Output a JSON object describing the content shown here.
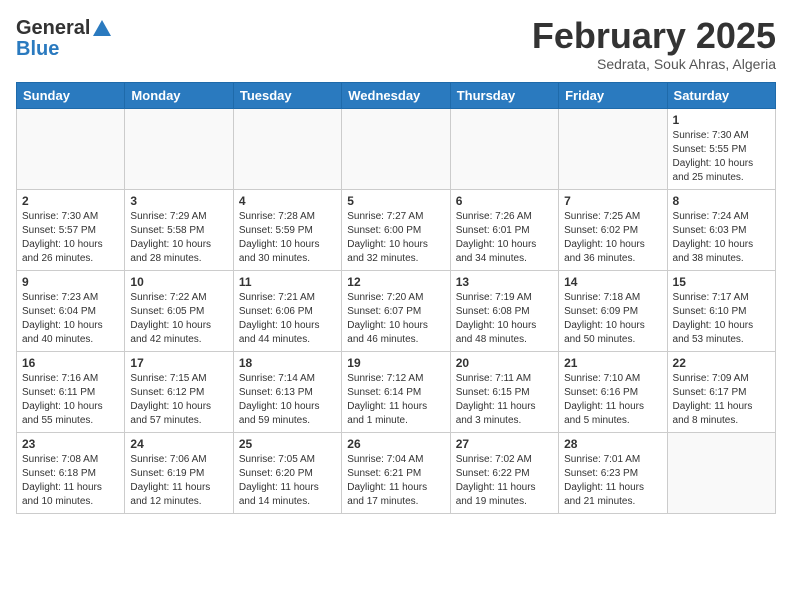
{
  "header": {
    "logo_line1": "General",
    "logo_line2": "Blue",
    "month": "February 2025",
    "location": "Sedrata, Souk Ahras, Algeria"
  },
  "days_of_week": [
    "Sunday",
    "Monday",
    "Tuesday",
    "Wednesday",
    "Thursday",
    "Friday",
    "Saturday"
  ],
  "weeks": [
    [
      {
        "day": "",
        "info": ""
      },
      {
        "day": "",
        "info": ""
      },
      {
        "day": "",
        "info": ""
      },
      {
        "day": "",
        "info": ""
      },
      {
        "day": "",
        "info": ""
      },
      {
        "day": "",
        "info": ""
      },
      {
        "day": "1",
        "info": "Sunrise: 7:30 AM\nSunset: 5:55 PM\nDaylight: 10 hours and 25 minutes."
      }
    ],
    [
      {
        "day": "2",
        "info": "Sunrise: 7:30 AM\nSunset: 5:57 PM\nDaylight: 10 hours and 26 minutes."
      },
      {
        "day": "3",
        "info": "Sunrise: 7:29 AM\nSunset: 5:58 PM\nDaylight: 10 hours and 28 minutes."
      },
      {
        "day": "4",
        "info": "Sunrise: 7:28 AM\nSunset: 5:59 PM\nDaylight: 10 hours and 30 minutes."
      },
      {
        "day": "5",
        "info": "Sunrise: 7:27 AM\nSunset: 6:00 PM\nDaylight: 10 hours and 32 minutes."
      },
      {
        "day": "6",
        "info": "Sunrise: 7:26 AM\nSunset: 6:01 PM\nDaylight: 10 hours and 34 minutes."
      },
      {
        "day": "7",
        "info": "Sunrise: 7:25 AM\nSunset: 6:02 PM\nDaylight: 10 hours and 36 minutes."
      },
      {
        "day": "8",
        "info": "Sunrise: 7:24 AM\nSunset: 6:03 PM\nDaylight: 10 hours and 38 minutes."
      }
    ],
    [
      {
        "day": "9",
        "info": "Sunrise: 7:23 AM\nSunset: 6:04 PM\nDaylight: 10 hours and 40 minutes."
      },
      {
        "day": "10",
        "info": "Sunrise: 7:22 AM\nSunset: 6:05 PM\nDaylight: 10 hours and 42 minutes."
      },
      {
        "day": "11",
        "info": "Sunrise: 7:21 AM\nSunset: 6:06 PM\nDaylight: 10 hours and 44 minutes."
      },
      {
        "day": "12",
        "info": "Sunrise: 7:20 AM\nSunset: 6:07 PM\nDaylight: 10 hours and 46 minutes."
      },
      {
        "day": "13",
        "info": "Sunrise: 7:19 AM\nSunset: 6:08 PM\nDaylight: 10 hours and 48 minutes."
      },
      {
        "day": "14",
        "info": "Sunrise: 7:18 AM\nSunset: 6:09 PM\nDaylight: 10 hours and 50 minutes."
      },
      {
        "day": "15",
        "info": "Sunrise: 7:17 AM\nSunset: 6:10 PM\nDaylight: 10 hours and 53 minutes."
      }
    ],
    [
      {
        "day": "16",
        "info": "Sunrise: 7:16 AM\nSunset: 6:11 PM\nDaylight: 10 hours and 55 minutes."
      },
      {
        "day": "17",
        "info": "Sunrise: 7:15 AM\nSunset: 6:12 PM\nDaylight: 10 hours and 57 minutes."
      },
      {
        "day": "18",
        "info": "Sunrise: 7:14 AM\nSunset: 6:13 PM\nDaylight: 10 hours and 59 minutes."
      },
      {
        "day": "19",
        "info": "Sunrise: 7:12 AM\nSunset: 6:14 PM\nDaylight: 11 hours and 1 minute."
      },
      {
        "day": "20",
        "info": "Sunrise: 7:11 AM\nSunset: 6:15 PM\nDaylight: 11 hours and 3 minutes."
      },
      {
        "day": "21",
        "info": "Sunrise: 7:10 AM\nSunset: 6:16 PM\nDaylight: 11 hours and 5 minutes."
      },
      {
        "day": "22",
        "info": "Sunrise: 7:09 AM\nSunset: 6:17 PM\nDaylight: 11 hours and 8 minutes."
      }
    ],
    [
      {
        "day": "23",
        "info": "Sunrise: 7:08 AM\nSunset: 6:18 PM\nDaylight: 11 hours and 10 minutes."
      },
      {
        "day": "24",
        "info": "Sunrise: 7:06 AM\nSunset: 6:19 PM\nDaylight: 11 hours and 12 minutes."
      },
      {
        "day": "25",
        "info": "Sunrise: 7:05 AM\nSunset: 6:20 PM\nDaylight: 11 hours and 14 minutes."
      },
      {
        "day": "26",
        "info": "Sunrise: 7:04 AM\nSunset: 6:21 PM\nDaylight: 11 hours and 17 minutes."
      },
      {
        "day": "27",
        "info": "Sunrise: 7:02 AM\nSunset: 6:22 PM\nDaylight: 11 hours and 19 minutes."
      },
      {
        "day": "28",
        "info": "Sunrise: 7:01 AM\nSunset: 6:23 PM\nDaylight: 11 hours and 21 minutes."
      },
      {
        "day": "",
        "info": ""
      }
    ]
  ]
}
